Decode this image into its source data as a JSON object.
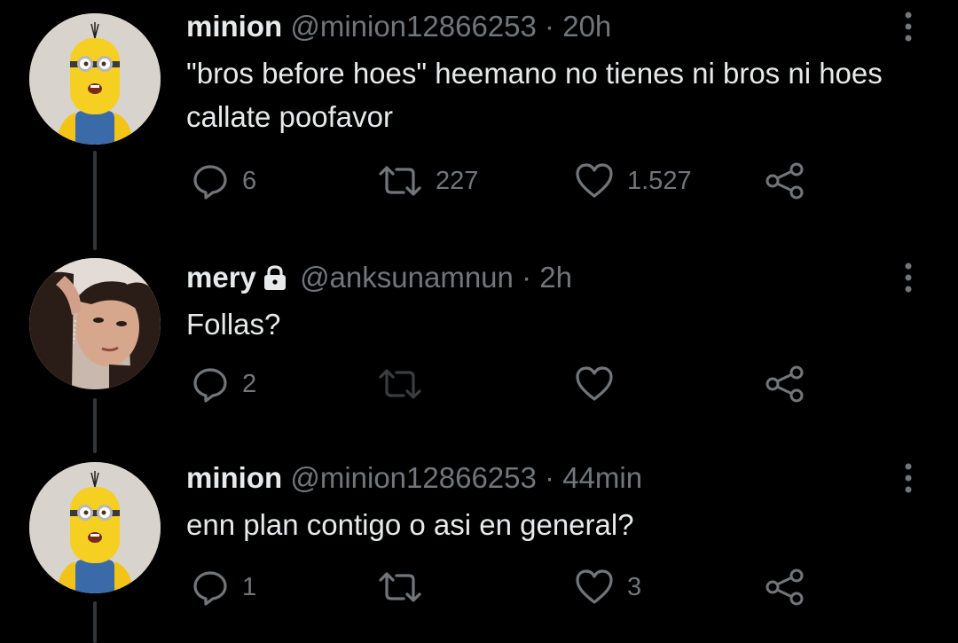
{
  "tweets": [
    {
      "name": "minion",
      "handle": "@minion12866253",
      "separator": "·",
      "time": "20h",
      "text": "\"bros before hoes\" heemano no tienes ni bros ni hoes callate poofavor",
      "avatar": "minion-avatar",
      "locked": false,
      "replies": "6",
      "retweets": "227",
      "likes": "1.527",
      "retweet_enabled": true
    },
    {
      "name": "mery",
      "handle": "@anksunamnun",
      "separator": "·",
      "time": "2h",
      "text": "Follas?",
      "avatar": "woman-photo-avatar",
      "locked": true,
      "replies": "2",
      "retweets": "",
      "likes": "",
      "retweet_enabled": false
    },
    {
      "name": "minion",
      "handle": "@minion12866253",
      "separator": "·",
      "time": "44min",
      "text": "enn plan contigo o asi en general?",
      "avatar": "minion-avatar",
      "locked": false,
      "replies": "1",
      "retweets": "",
      "likes": "3",
      "retweet_enabled": true
    }
  ],
  "colors": {
    "background": "#000000",
    "text_primary": "#e7e9ea",
    "text_secondary": "#71767b",
    "thread_line": "#333639",
    "retweet_disabled": "#3a3d40"
  },
  "icons": [
    "reply-icon",
    "retweet-icon",
    "like-icon",
    "share-icon",
    "more-options-icon",
    "lock-icon"
  ]
}
